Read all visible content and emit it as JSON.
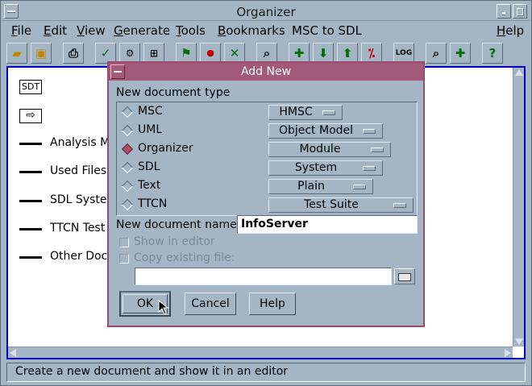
{
  "window": {
    "title": "Organizer"
  },
  "menubar": [
    {
      "label": "File",
      "mnemonic": "F",
      "rest": "ile"
    },
    {
      "label": "Edit",
      "mnemonic": "E",
      "rest": "dit"
    },
    {
      "label": "View",
      "mnemonic": "V",
      "rest": "iew"
    },
    {
      "label": "Generate",
      "mnemonic": "G",
      "rest": "enerate"
    },
    {
      "label": "Tools",
      "mnemonic": "T",
      "rest": "ools"
    },
    {
      "label": "Bookmarks",
      "mnemonic": "B",
      "rest": "ookmarks"
    },
    {
      "label": "MSC to SDL",
      "mnemonic": "",
      "rest": "MSC to SDL"
    },
    {
      "label": "Help",
      "mnemonic": "H",
      "rest": "elp"
    }
  ],
  "toolbar": {
    "icons": [
      "open-folder-icon",
      "save-disk-icon",
      "print-icon",
      "check-icon",
      "analyze-icon",
      "generate-icon",
      "organize-icon",
      "ok-approve-icon",
      "close-x-icon",
      "search-document-icon",
      "add-up-icon",
      "arrow-down-icon",
      "arrow-up-icon",
      "remove-icon",
      "log-icon",
      "zoom-icon",
      "zoom-plus-icon",
      "help-question-icon"
    ],
    "log_label": "LOG"
  },
  "tree": {
    "sdt_label": "SDT",
    "items": [
      "Analysis Mo",
      "Used Files",
      "SDL Syster",
      "TTCN Test",
      "Other Docu"
    ]
  },
  "status": {
    "text": "Create a new document and show it in an editor"
  },
  "dialog": {
    "title": "Add New",
    "type_heading": "New document type",
    "types": [
      {
        "label": "MSC",
        "option": "HMSC",
        "selected": false
      },
      {
        "label": "UML",
        "option": "Object Model",
        "selected": false
      },
      {
        "label": "Organizer",
        "option": "Module",
        "selected": true
      },
      {
        "label": "SDL",
        "option": "System",
        "selected": false
      },
      {
        "label": "Text",
        "option": "Plain",
        "selected": false
      },
      {
        "label": "TTCN",
        "option": "Test Suite",
        "selected": false
      }
    ],
    "name_label": "New document name:",
    "name_value": "InfoServer",
    "show_in_editor": "Show in editor",
    "copy_existing": "Copy existing file:",
    "copy_path_value": "",
    "ok": "OK",
    "cancel": "Cancel",
    "help": "Help"
  },
  "colors": {
    "window_bg": "#a4b6c6",
    "dialog_title_bg": "#a25a78",
    "selected_radio": "#b04a6a",
    "workspace_border": "#0000c0"
  }
}
